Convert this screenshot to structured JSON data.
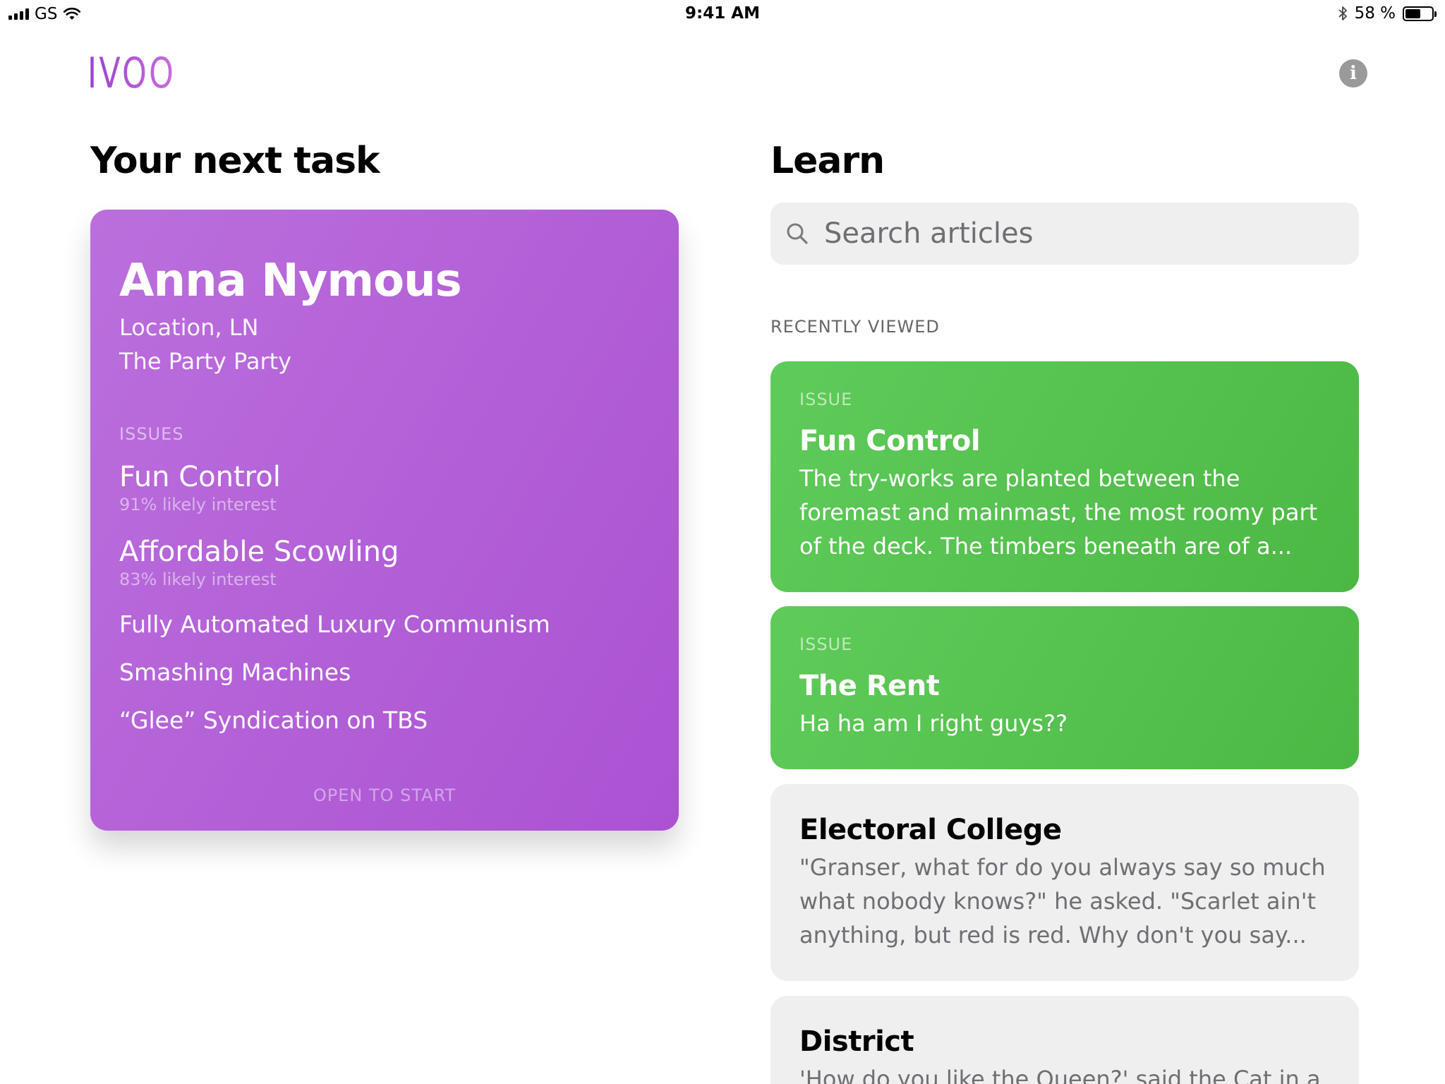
{
  "status_bar": {
    "carrier": "GS",
    "time": "9:41 AM",
    "battery_percent": "58 %",
    "battery_level": 0.58
  },
  "header": {
    "logo_text": "IVOO",
    "info_icon": "info-icon"
  },
  "task_section": {
    "title": "Your next task",
    "card": {
      "name": "Anna Nymous",
      "location": "Location, LN",
      "party": "The Party Party",
      "issues_heading": "ISSUES",
      "issues": [
        {
          "name": "Fun Control",
          "interest": "91% likely interest"
        },
        {
          "name": "Affordable Scowling",
          "interest": "83% likely interest"
        },
        {
          "name": "Fully Automated Luxury Communism"
        },
        {
          "name": "Smashing Machines"
        },
        {
          "name": "“Glee” Syndication on TBS"
        }
      ],
      "cta": "OPEN TO START"
    }
  },
  "learn_section": {
    "title": "Learn",
    "search": {
      "placeholder": "Search articles",
      "value": ""
    },
    "recent_heading": "RECENTLY VIEWED",
    "articles": [
      {
        "tag": "ISSUE",
        "title": "Fun Control",
        "body": "The try-works are planted between the foremast and mainmast, the most roomy part of the deck. The timbers beneath are of a..."
      },
      {
        "tag": "ISSUE",
        "title": "The Rent",
        "body": "Ha ha am I right guys??"
      },
      {
        "title": "Electoral College",
        "body": "\"Granser, what for do you always say so much what nobody knows?\" he asked. \"Scarlet ain't anything, but red is red. Why don't you say..."
      },
      {
        "title": "District",
        "body": "'How do you like the Queen?' said the Cat in a"
      }
    ]
  },
  "colors": {
    "task_card_start": "#bb6fdc",
    "task_card_end": "#ab52d3",
    "issue_card_green": "#55c24f",
    "article_card_gray": "#efefef"
  }
}
